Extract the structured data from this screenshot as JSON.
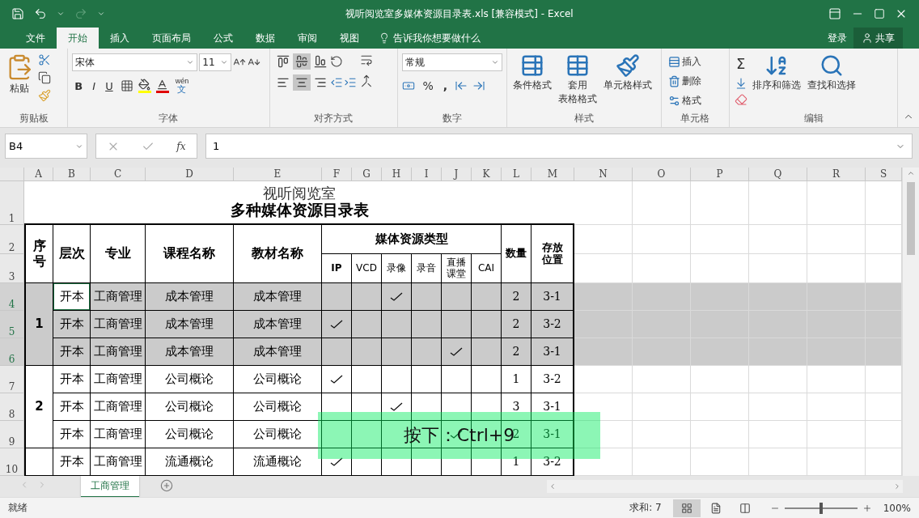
{
  "title_bar": {
    "title": "视听阅览室多媒体资源目录表.xls  [兼容模式] - Excel"
  },
  "tabs": [
    {
      "label": "文件",
      "selected": false
    },
    {
      "label": "开始",
      "selected": true
    },
    {
      "label": "插入",
      "selected": false
    },
    {
      "label": "页面布局",
      "selected": false
    },
    {
      "label": "公式",
      "selected": false
    },
    {
      "label": "数据",
      "selected": false
    },
    {
      "label": "审阅",
      "selected": false
    },
    {
      "label": "视图",
      "selected": false
    }
  ],
  "tell_me": "告诉我你想要做什么",
  "sign_in": "登录",
  "share": "共享",
  "ribbon": {
    "clipboard": {
      "paste": "粘贴",
      "label": "剪贴板"
    },
    "font": {
      "name": "宋体",
      "size": "11",
      "styles": [
        "B",
        "I",
        "U"
      ],
      "phonetic_top": "wén",
      "phonetic_bottom": "文",
      "label": "字体"
    },
    "alignment": {
      "vertical": [
        {
          "selected": false
        },
        {
          "selected": true
        },
        {
          "selected": false
        }
      ],
      "horizontal": [
        {
          "selected": false
        },
        {
          "selected": true
        },
        {
          "selected": false
        }
      ],
      "label": "对齐方式"
    },
    "number": {
      "format": "常规",
      "percent": "%",
      "comma": ",",
      "label": "数字"
    },
    "styles": {
      "buttons": [
        {
          "lines": [
            "条件格式"
          ]
        },
        {
          "lines": [
            "套用",
            "表格格式"
          ]
        },
        {
          "lines": [
            "单元格样式"
          ]
        }
      ],
      "label": "样式"
    },
    "cells": {
      "buttons": [
        "插入",
        "删除",
        "格式"
      ],
      "label": "单元格"
    },
    "editing": {
      "sum": "Σ",
      "buttons": [
        "排序和筛选",
        "查找和选择"
      ],
      "label": "编辑"
    }
  },
  "formula_bar": {
    "name_box": "B4",
    "fx": "fx",
    "value": "1"
  },
  "columns": [
    "A",
    "B",
    "C",
    "D",
    "E",
    "F",
    "G",
    "H",
    "I",
    "J",
    "K",
    "L",
    "M",
    "N",
    "O",
    "P",
    "Q",
    "R",
    "S"
  ],
  "rows": [
    {
      "label": "1",
      "selected": false
    },
    {
      "label": "2",
      "selected": false
    },
    {
      "label": "3",
      "selected": false
    },
    {
      "label": "4",
      "selected": true
    },
    {
      "label": "5",
      "selected": true
    },
    {
      "label": "6",
      "selected": true
    },
    {
      "label": "7",
      "selected": false
    },
    {
      "label": "8",
      "selected": false
    },
    {
      "label": "9",
      "selected": false
    },
    {
      "label": "10",
      "selected": false
    }
  ],
  "sheet": {
    "title": "视听阅览室",
    "subtitle": "多种媒体资源目录表",
    "headers": [
      "序号",
      "层次",
      "专业",
      "课程名称",
      "教材名称"
    ],
    "media_header": "媒体资源类型",
    "media_types": [
      "IP",
      "VCD",
      "录像",
      "录音",
      "直播课堂",
      "CAI"
    ],
    "tail_headers": [
      "数量",
      "存放位置"
    ],
    "groups": [
      {
        "number": "1",
        "selected": true,
        "records": [
          {
            "level": "开本",
            "major": "工商管理",
            "course": "成本管理",
            "textbook": "成本管理",
            "media": [
              false,
              false,
              true,
              false,
              false,
              false
            ],
            "count": "2",
            "location": "3-1",
            "selected": true,
            "active": true
          },
          {
            "level": "开本",
            "major": "工商管理",
            "course": "成本管理",
            "textbook": "成本管理",
            "media": [
              true,
              false,
              false,
              false,
              false,
              false
            ],
            "count": "2",
            "location": "3-2",
            "selected": true,
            "active": false
          },
          {
            "level": "开本",
            "major": "工商管理",
            "course": "成本管理",
            "textbook": "成本管理",
            "media": [
              false,
              false,
              false,
              false,
              true,
              false
            ],
            "count": "2",
            "location": "3-1",
            "selected": true,
            "active": false
          }
        ]
      },
      {
        "number": "2",
        "selected": false,
        "records": [
          {
            "level": "开本",
            "major": "工商管理",
            "course": "公司概论",
            "textbook": "公司概论",
            "media": [
              true,
              false,
              false,
              false,
              false,
              false
            ],
            "count": "1",
            "location": "3-2",
            "selected": false,
            "active": false
          },
          {
            "level": "开本",
            "major": "工商管理",
            "course": "公司概论",
            "textbook": "公司概论",
            "media": [
              false,
              false,
              true,
              false,
              false,
              false
            ],
            "count": "3",
            "location": "3-1",
            "selected": false,
            "active": false
          },
          {
            "level": "开本",
            "major": "工商管理",
            "course": "公司概论",
            "textbook": "公司概论",
            "media": [
              false,
              false,
              false,
              false,
              true,
              false
            ],
            "count": "2",
            "location": "3-1",
            "selected": false,
            "active": false
          }
        ]
      },
      {
        "selected": false,
        "records": [
          {
            "level": "开本",
            "major": "工商管理",
            "course": "流通概论",
            "textbook": "流通概论",
            "media": [
              true,
              false,
              false,
              false,
              false,
              false
            ],
            "count": "1",
            "location": "3-2",
            "selected": false,
            "active": false
          }
        ]
      }
    ]
  },
  "overlay": {
    "text": "按下：Ctrl+9"
  },
  "sheet_tabs": [
    {
      "label": "工商管理",
      "selected": true
    }
  ],
  "status_bar": {
    "text": "就绪",
    "sum": "求和: 7",
    "views": [
      {
        "kind": "normal",
        "selected": true
      },
      {
        "kind": "page-layout",
        "selected": false
      },
      {
        "kind": "page-break",
        "selected": false
      }
    ],
    "zoom_slider": {
      "level": 0.5
    },
    "zoom": "100%"
  }
}
